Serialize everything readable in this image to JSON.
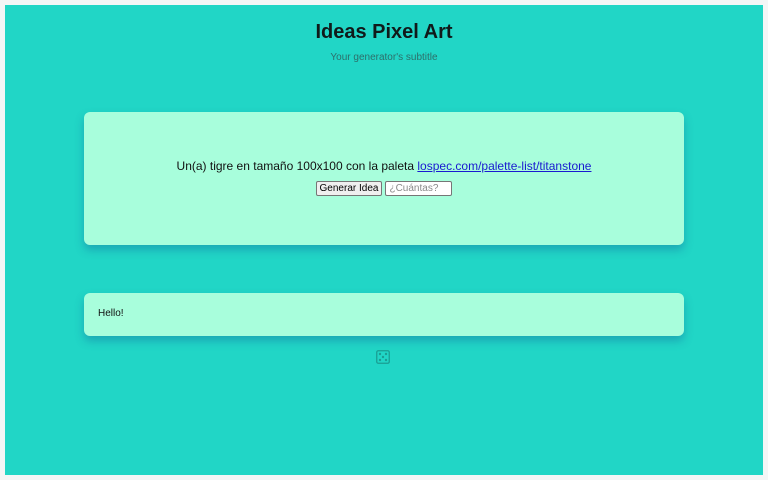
{
  "header": {
    "title": "Ideas Pixel Art",
    "subtitle": "Your generator's subtitle"
  },
  "idea": {
    "text": "Un(a) tigre en tamaño 100x100 con la paleta",
    "palette_link_text": "lospec.com/palette-list/titanstone"
  },
  "controls": {
    "generate_label": "Generar Idea",
    "count_placeholder": "¿Cuántas?",
    "count_value": ""
  },
  "output": {
    "message": "Hello!"
  },
  "icons": {
    "footer_icon": "dice-icon"
  },
  "colors": {
    "background": "#21d6c6",
    "card": "#a8fedc",
    "link": "#1a1ad0"
  }
}
